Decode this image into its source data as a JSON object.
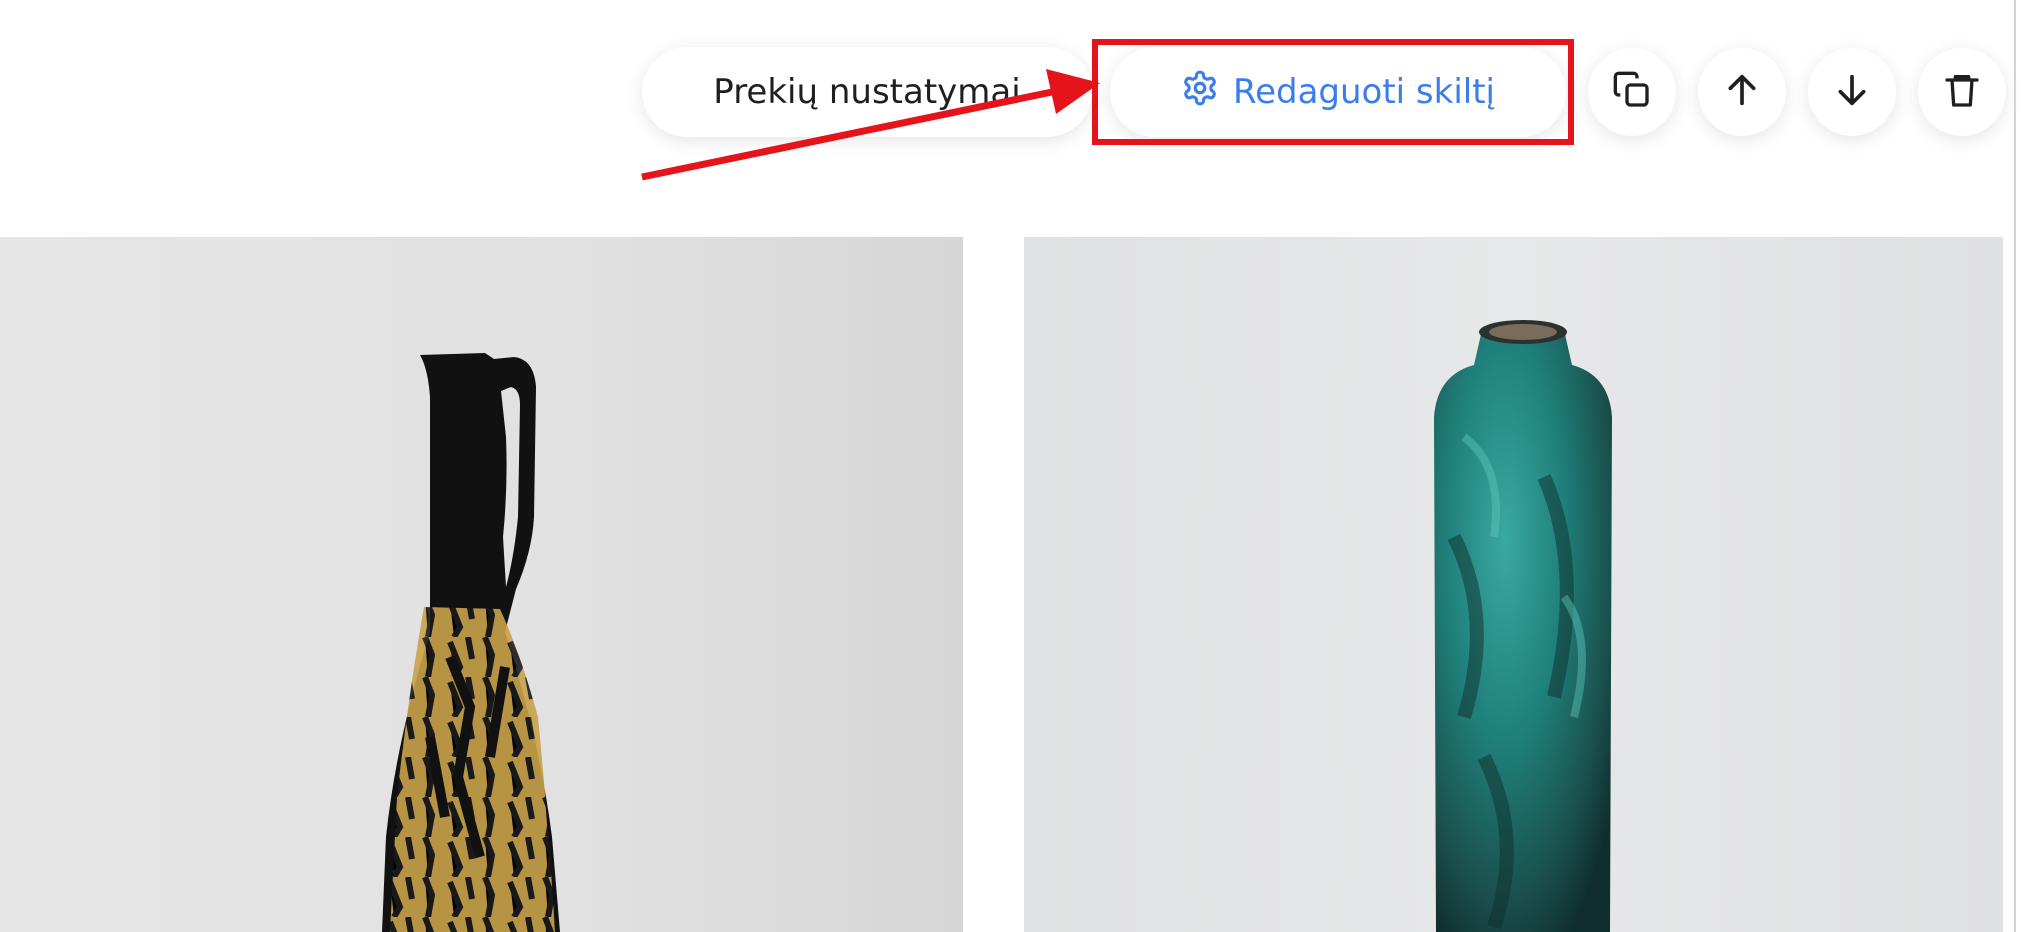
{
  "toolbar": {
    "settings_label": "Prekių nustatymai",
    "edit_label": "Redaguoti skiltį",
    "edit_icon": "gear-icon",
    "duplicate_icon": "duplicate-icon",
    "move_up_icon": "arrow-up-icon",
    "move_down_icon": "arrow-down-icon",
    "delete_icon": "trash-icon"
  },
  "colors": {
    "accent": "#3b7de9",
    "annotation": "#e5141a",
    "text": "#1f1f1f"
  },
  "products": [
    {
      "image": "black-gold-jug-vase"
    },
    {
      "image": "teal-patina-vase"
    }
  ]
}
